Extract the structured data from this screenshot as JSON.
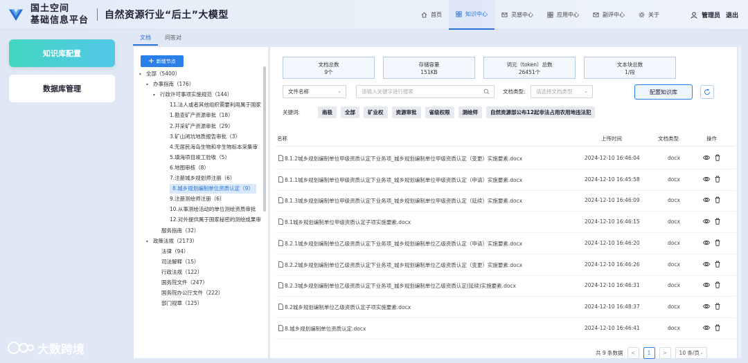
{
  "app": {
    "title_line1": "国土空间",
    "title_line2": "基础信息平台",
    "model_title": "自然资源行业“后土”大模型"
  },
  "nav": [
    {
      "label": "首页",
      "icon": "home-icon"
    },
    {
      "label": "知识中心",
      "icon": "grid-icon",
      "active": true
    },
    {
      "label": "灵感中心",
      "icon": "mail-icon"
    },
    {
      "label": "应用中心",
      "icon": "app-grid-icon"
    },
    {
      "label": "副评中心",
      "icon": "mail-icon"
    },
    {
      "label": "关于",
      "icon": "gear-icon"
    }
  ],
  "user": {
    "name": "管理员",
    "logout": "退出"
  },
  "sidebar": {
    "items": [
      {
        "label": "知识库配置",
        "active": true
      },
      {
        "label": "数据库管理"
      }
    ]
  },
  "watermark": "大数跨境",
  "tabs": [
    {
      "label": "文档",
      "active": true
    },
    {
      "label": "问答对"
    }
  ],
  "tree": {
    "add_label": "新增节点",
    "nodes": [
      {
        "label": "全部（5400）",
        "caret": "▾"
      },
      {
        "label": "办事指南（176）",
        "caret": "▾"
      },
      {
        "label": "行政许可事项实施规范（144）",
        "caret": "▾"
      },
      {
        "label": "11.法人或者其他组织需要利用属于国家",
        "caret": ""
      },
      {
        "label": "1.勘查矿产资源审批（18）",
        "caret": ""
      },
      {
        "label": "2.开采矿产资源审批（29）",
        "caret": ""
      },
      {
        "label": "3.矿山闭坑地质报告审批（3）",
        "caret": ""
      },
      {
        "label": "4.无居民海岛生物和非生物标本采集审",
        "caret": ""
      },
      {
        "label": "5.填海项目竣工验收（5）",
        "caret": ""
      },
      {
        "label": "6.地图审核（8）",
        "caret": ""
      },
      {
        "label": "7.注册城乡规划师注册（6）",
        "caret": ""
      },
      {
        "label": "8.城乡规划编制单位资质认定（9）",
        "caret": ""
      },
      {
        "label": "9.注册测绘师注册（6）",
        "caret": ""
      },
      {
        "label": "10.从事测绘活动的单位测绘资质审批",
        "caret": ""
      },
      {
        "label": "12.对外提供属于国家秘密的测绘成果审",
        "caret": ""
      },
      {
        "label": "服务指南（32）",
        "caret": ""
      },
      {
        "label": "政策法规（2173）",
        "caret": "▾"
      },
      {
        "label": "法律（94）",
        "caret": ""
      },
      {
        "label": "司法解释（15）",
        "caret": ""
      },
      {
        "label": "行政法规（122）",
        "caret": ""
      },
      {
        "label": "国务院文件（247）",
        "caret": ""
      },
      {
        "label": "国务院办公厅文件（222）",
        "caret": ""
      },
      {
        "label": "部门规章（125）",
        "caret": ""
      }
    ]
  },
  "stats": [
    {
      "label": "文档总数",
      "value": "9个"
    },
    {
      "label": "存储容量",
      "value": "151KB"
    },
    {
      "label": "词元（token）总数",
      "value": "26451个"
    },
    {
      "label": "文本块总数",
      "value": "1/段"
    }
  ],
  "filters": {
    "field_select": "文件名称",
    "search_placeholder": "请输入关键字进行搜索",
    "type_label": "文档类型:",
    "type_placeholder": "请选择文档类型",
    "config_button": "配置知识库"
  },
  "keywords": {
    "label": "关键词:",
    "items": [
      "南极",
      "全部",
      "矿业权",
      "资源审批",
      "省级权限",
      "测绘师",
      "自然资源部公布12起非法占用农用地违法犯"
    ]
  },
  "table": {
    "headers": {
      "name": "名称",
      "time": "上传时间",
      "type": "文档类型",
      "ops": "操作"
    },
    "rows": [
      {
        "name": "8.1.2城乡规划编制单位甲级资质认定下业务项_城乡规划编制单位甲级资质认定（变更）实施要素.docx",
        "time": "2024-12-10 16:46:04",
        "type": "docx"
      },
      {
        "name": "8.1.1城乡规划编制单位甲级资质认定下业务项_城乡规划编制单位甲级资质认定（申请）实施要素.docx",
        "time": "2024-12-10 16:45:58",
        "type": "docx"
      },
      {
        "name": "8.1.3城乡规划编制单位甲级资质认定下业务项_城乡规划编制单位甲级资质认定（延续）实施要素.docx",
        "time": "2024-12-10 16:46:09",
        "type": "docx"
      },
      {
        "name": "8.1城乡规划编制单位甲级资质认定子项实施要素.docx",
        "time": "2024-12-10 16:46:15",
        "type": "docx"
      },
      {
        "name": "8.2.1城乡规划编制单位乙级资质认定下业务项_城乡规划编制单位乙级资质认定（申请）实施要素.docx",
        "time": "2024-12-10 16:46:20",
        "type": "docx"
      },
      {
        "name": "8.2.2城乡规划编制单位乙级资质认定下业务项_城乡规划编制单位乙级资质认定（变更）实施要素.docx",
        "time": "2024-12-10 16:46:26",
        "type": "docx"
      },
      {
        "name": "8.2.3城乡规划编制单位乙级资质认定下业务项_城乡规划编制单位乙级资质认定(延续)实施要素.docx",
        "time": "2024-12-10 16:46:31",
        "type": "docx"
      },
      {
        "name": "8.2城乡规划编制单位乙级资质认定子项实施要素.docx",
        "time": "2024-12-10 16:48:37",
        "type": "docx"
      },
      {
        "name": "8.城乡规划编制单位资质认定.docx",
        "time": "2024-12-10 16:46:41",
        "type": "docx"
      }
    ]
  },
  "pager": {
    "total": "共 9 条数据",
    "prev": "<",
    "page": "1",
    "next": ">",
    "size": "10 条/页"
  },
  "colors": {
    "accent": "#2b80e8",
    "sidebar_active": "#42d6c0"
  }
}
